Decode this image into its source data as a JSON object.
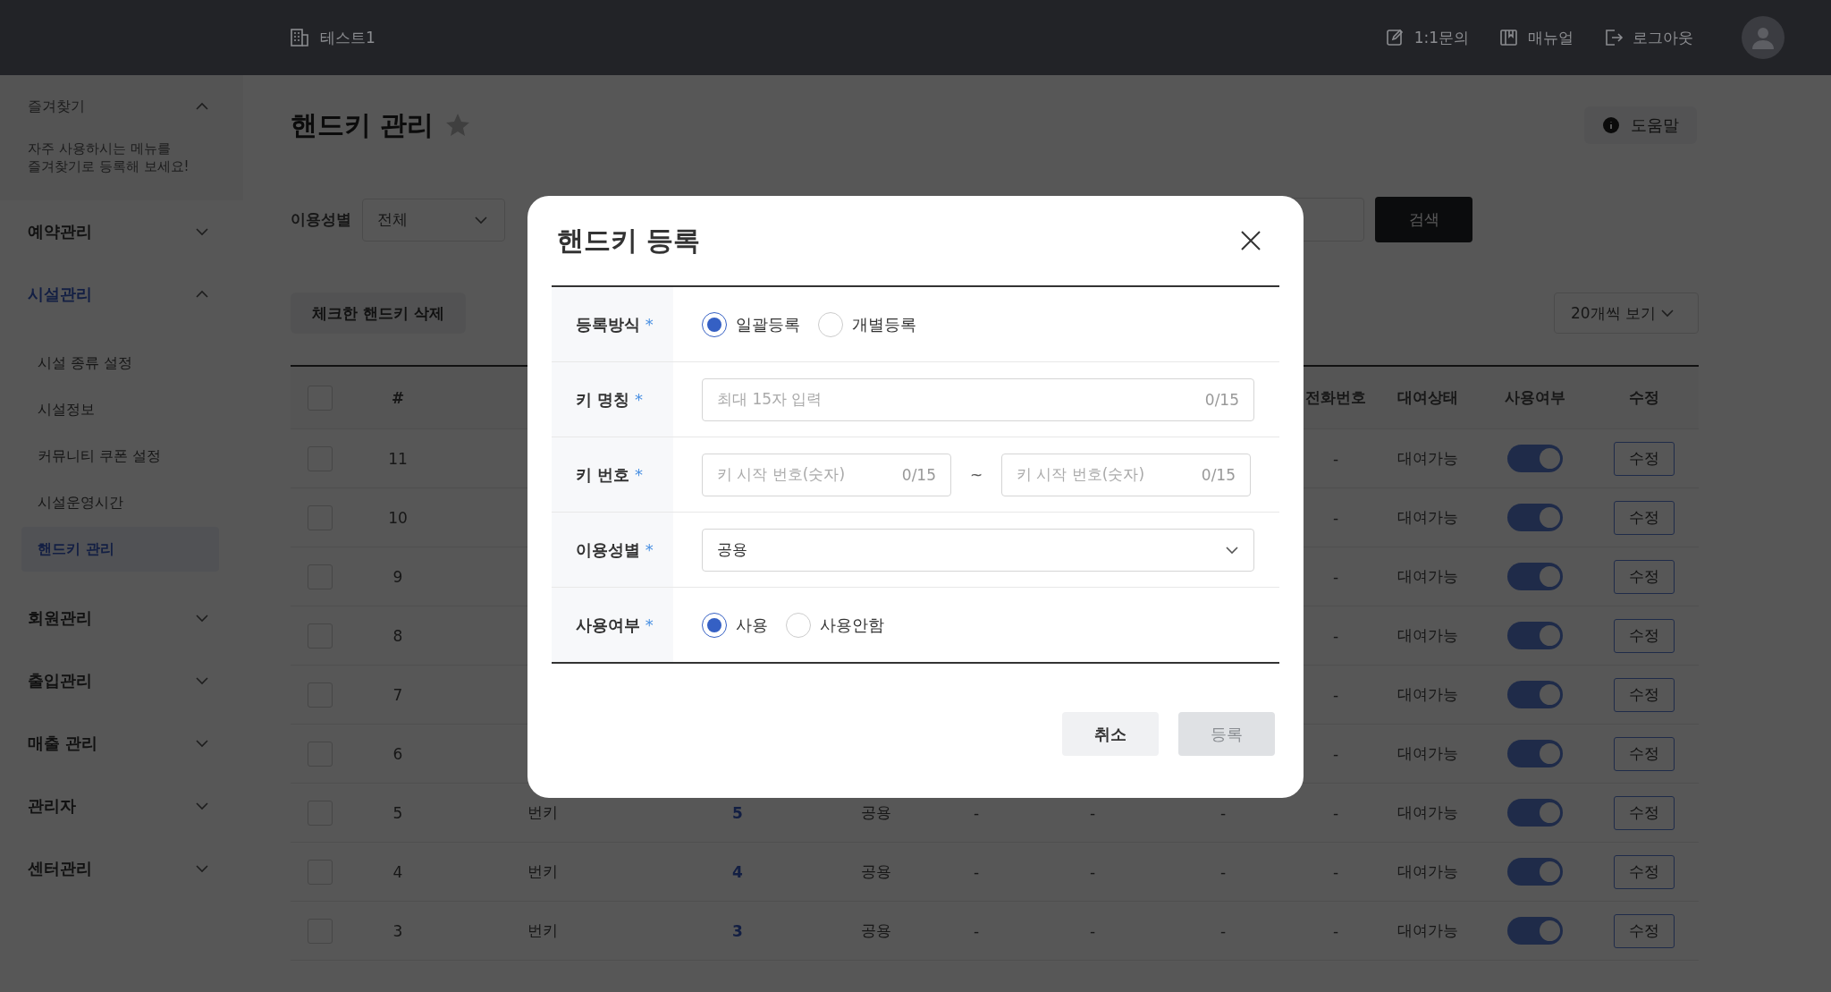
{
  "topbar": {
    "site": "테스트1",
    "links": [
      {
        "kind": "inquiry",
        "label": "1:1문의"
      },
      {
        "kind": "manual",
        "label": "매뉴얼"
      },
      {
        "kind": "logout",
        "label": "로그아웃"
      }
    ]
  },
  "sidebar": {
    "favorites": {
      "title": "즐겨찾기",
      "expanded": true,
      "hint": "자주 사용하시는 메뉴를\n즐겨찾기로 등록해 보세요!"
    },
    "menus": [
      {
        "label": "예약관리",
        "expanded": false,
        "selected": false
      },
      {
        "label": "시설관리",
        "expanded": true,
        "selected": true,
        "children": [
          {
            "label": "시설 종류 설정",
            "selected": false
          },
          {
            "label": "시설정보",
            "selected": false
          },
          {
            "label": "커뮤니티 쿠폰 설정",
            "selected": false
          },
          {
            "label": "시설운영시간",
            "selected": false
          },
          {
            "label": "핸드키 관리",
            "selected": true
          }
        ]
      },
      {
        "label": "회원관리",
        "expanded": false,
        "selected": false
      },
      {
        "label": "출입관리",
        "expanded": false,
        "selected": false
      },
      {
        "label": "매출 관리",
        "expanded": false,
        "selected": false
      },
      {
        "label": "관리자",
        "expanded": false,
        "selected": false
      },
      {
        "label": "센터관리",
        "expanded": false,
        "selected": false
      }
    ]
  },
  "page": {
    "title": "핸드키 관리",
    "favorite": false,
    "help": "도움말"
  },
  "filter": {
    "label": "이용성별",
    "select": "전체",
    "search_button": "검색"
  },
  "actions": {
    "delete": "체크한 핸드키 삭제",
    "page_size": "20개씩 보기"
  },
  "table": {
    "header": {
      "checked": false,
      "number": "#",
      "phone": "전화번호",
      "status": "대여상태",
      "used": "사용여부",
      "edit": "수정"
    },
    "rows": [
      {
        "checked": false,
        "number": "11",
        "phone": "-",
        "status": "대여가능",
        "used": true,
        "edit": "수정"
      },
      {
        "checked": false,
        "number": "10",
        "phone": "-",
        "status": "대여가능",
        "used": true,
        "edit": "수정"
      },
      {
        "checked": false,
        "number": "9",
        "phone": "-",
        "status": "대여가능",
        "used": true,
        "edit": "수정"
      },
      {
        "checked": false,
        "number": "8",
        "phone": "-",
        "status": "대여가능",
        "used": true,
        "edit": "수정"
      },
      {
        "checked": false,
        "number": "7",
        "phone": "-",
        "status": "대여가능",
        "used": true,
        "edit": "수정"
      },
      {
        "checked": false,
        "number": "6",
        "phone": "-",
        "status": "대여가능",
        "used": true,
        "edit": "수정"
      },
      {
        "checked": false,
        "number": "5",
        "key_name": "번키",
        "key_number": "5",
        "gender": "공용",
        "column_6": "-",
        "column_7": "-",
        "column_8": "-",
        "phone": "-",
        "status": "대여가능",
        "used": true,
        "edit": "수정"
      },
      {
        "checked": false,
        "number": "4",
        "key_name": "번키",
        "key_number": "4",
        "gender": "공용",
        "column_6": "-",
        "column_7": "-",
        "column_8": "-",
        "phone": "-",
        "status": "대여가능",
        "used": true,
        "edit": "수정"
      },
      {
        "checked": false,
        "number": "3",
        "key_name": "번키",
        "key_number": "3",
        "gender": "공용",
        "column_6": "-",
        "column_7": "-",
        "column_8": "-",
        "phone": "-",
        "status": "대여가능",
        "used": true,
        "edit": "수정"
      }
    ]
  },
  "modal": {
    "title": "핸드키 등록",
    "required_mark": "*",
    "fields": [
      {
        "kind": "radio",
        "label": "등록방식",
        "required": true,
        "options": [
          {
            "label": "일괄등록",
            "selected": true
          },
          {
            "label": "개별등록",
            "selected": false
          }
        ]
      },
      {
        "kind": "text",
        "label": "키 명칭",
        "required": true,
        "placeholder": "최대 15자 입력",
        "counter": "0/15"
      },
      {
        "kind": "range",
        "label": "키 번호",
        "required": true,
        "separator": "~",
        "inputs": [
          {
            "placeholder": "키 시작 번호(숫자)",
            "counter": "0/15"
          },
          {
            "placeholder": "키 시작 번호(숫자)",
            "counter": "0/15"
          }
        ]
      },
      {
        "kind": "select",
        "label": "이용성별",
        "required": true,
        "value": "공용"
      },
      {
        "kind": "radio",
        "label": "사용여부",
        "required": true,
        "options": [
          {
            "label": "사용",
            "selected": true
          },
          {
            "label": "사용안함",
            "selected": false
          }
        ]
      }
    ],
    "buttons": [
      {
        "kind": "cancel",
        "label": "취소",
        "disabled": false
      },
      {
        "kind": "submit",
        "label": "등록",
        "disabled": true
      }
    ]
  }
}
